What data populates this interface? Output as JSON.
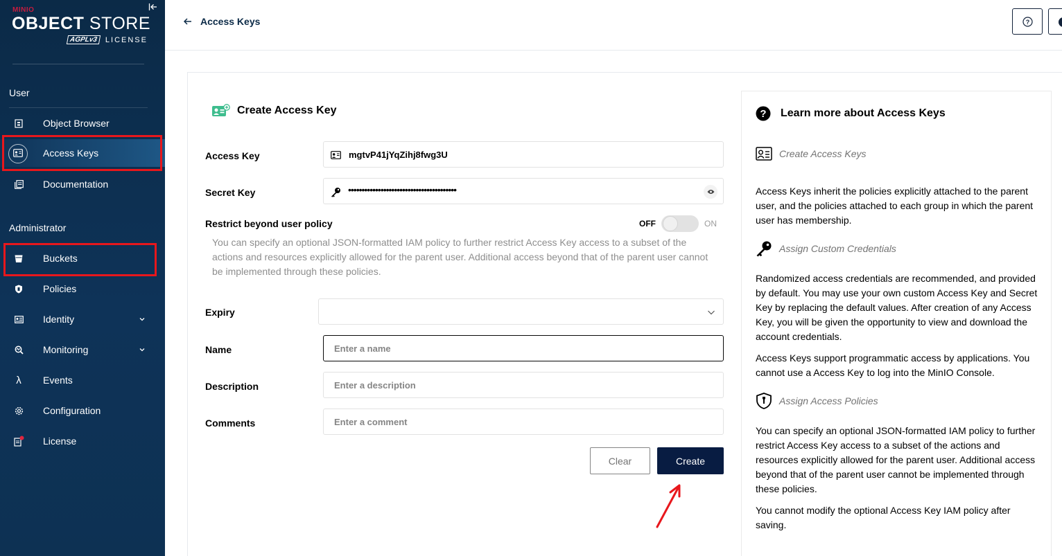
{
  "brand": {
    "minio": "MINIO",
    "title_bold": "OBJECT",
    "title_light": "STORE",
    "agpl": "AGPLv3",
    "license": "LICENSE"
  },
  "sidebar": {
    "user_section": "User",
    "admin_section": "Administrator",
    "items": [
      {
        "label": "Object Browser",
        "icon": "object-browser-icon"
      },
      {
        "label": "Access Keys",
        "icon": "access-keys-icon",
        "active": true
      },
      {
        "label": "Documentation",
        "icon": "documentation-icon"
      },
      {
        "label": "Buckets",
        "icon": "buckets-icon"
      },
      {
        "label": "Policies",
        "icon": "policies-icon"
      },
      {
        "label": "Identity",
        "icon": "identity-icon",
        "expandable": true
      },
      {
        "label": "Monitoring",
        "icon": "monitoring-icon",
        "expandable": true
      },
      {
        "label": "Events",
        "icon": "lambda-icon"
      },
      {
        "label": "Configuration",
        "icon": "gear-icon"
      },
      {
        "label": "License",
        "icon": "license-icon"
      }
    ]
  },
  "header": {
    "back_label": "Access Keys"
  },
  "form": {
    "title": "Create Access Key",
    "access_key_label": "Access Key",
    "access_key_value": "mgtvP41jYqZihj8fwg3U",
    "secret_key_label": "Secret Key",
    "secret_key_masked": "••••••••••••••••••••••••••••••••••••••••",
    "restrict_label": "Restrict beyond user policy",
    "toggle_off": "OFF",
    "toggle_on": "ON",
    "restrict_help": "You can specify an optional JSON-formatted IAM policy to further restrict Access Key access to a subset of the actions and resources explicitly allowed for the parent user. Additional access beyond that of the parent user cannot be implemented through these policies.",
    "expiry_label": "Expiry",
    "expiry_value": "",
    "name_label": "Name",
    "name_placeholder": "Enter a name",
    "description_label": "Description",
    "description_placeholder": "Enter a description",
    "comments_label": "Comments",
    "comments_placeholder": "Enter a comment",
    "clear_button": "Clear",
    "create_button": "Create"
  },
  "help": {
    "title": "Learn more about Access Keys",
    "sections": [
      {
        "heading": "Create Access Keys",
        "paragraphs": [
          "Access Keys inherit the policies explicitly attached to the parent user, and the policies attached to each group in which the parent user has membership."
        ]
      },
      {
        "heading": "Assign Custom Credentials",
        "paragraphs": [
          "Randomized access credentials are recommended, and provided by default. You may use your own custom Access Key and Secret Key by replacing the default values. After creation of any Access Key, you will be given the opportunity to view and download the account credentials.",
          "Access Keys support programmatic access by applications. You cannot use a Access Key to log into the MinIO Console."
        ]
      },
      {
        "heading": "Assign Access Policies",
        "paragraphs": [
          "You can specify an optional JSON-formatted IAM policy to further restrict Access Key access to a subset of the actions and resources explicitly allowed for the parent user. Additional access beyond that of the parent user cannot be implemented through these policies.",
          "You cannot modify the optional Access Key IAM policy after saving."
        ]
      }
    ]
  },
  "colors": {
    "sidebar_bg": "#0b2a47",
    "primary_button": "#081c42",
    "highlight_box": "#e8171c",
    "brand_red": "#c51c3f"
  }
}
